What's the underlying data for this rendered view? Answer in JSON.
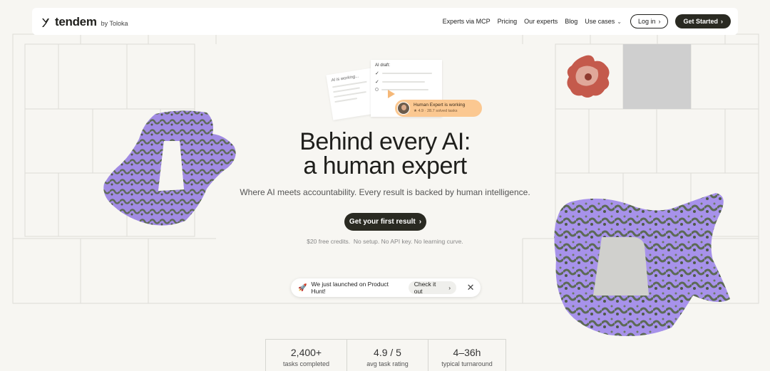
{
  "brand": {
    "name": "tendem",
    "by": "by Toloka"
  },
  "nav": {
    "links": [
      "Experts via MCP",
      "Pricing",
      "Our experts",
      "Blog"
    ],
    "use_cases": "Use cases",
    "login": "Log in",
    "get_started": "Get Started"
  },
  "illustration": {
    "ai_working": "AI is working...",
    "ai_draft": "AI draft:",
    "expert_title": "Human Expert is working",
    "expert_meta": "★ 4.9 · 28.7 solved tasks"
  },
  "hero": {
    "title_line1": "Behind every AI:",
    "title_line2": "a human expert",
    "subtitle": "Where AI meets accountability. Every result is backed by human intelligence.",
    "cta": "Get your first result",
    "note": "$20 free credits.  No setup. No API key. No learning curve."
  },
  "toast": {
    "text": "We just launched on Product Hunt!",
    "button": "Check it out"
  },
  "stats": [
    {
      "value": "2,400+",
      "label": "tasks completed"
    },
    {
      "value": "4.9 / 5",
      "label": "avg task rating"
    },
    {
      "value": "4–36h",
      "label": "typical turnaround"
    }
  ],
  "colors": {
    "background": "#f7f6f2",
    "dark_button": "#2a2a22",
    "accent_orange": "#fbc891",
    "blob_lavender": "#a48ee6",
    "blob_green": "#5c6a55"
  }
}
